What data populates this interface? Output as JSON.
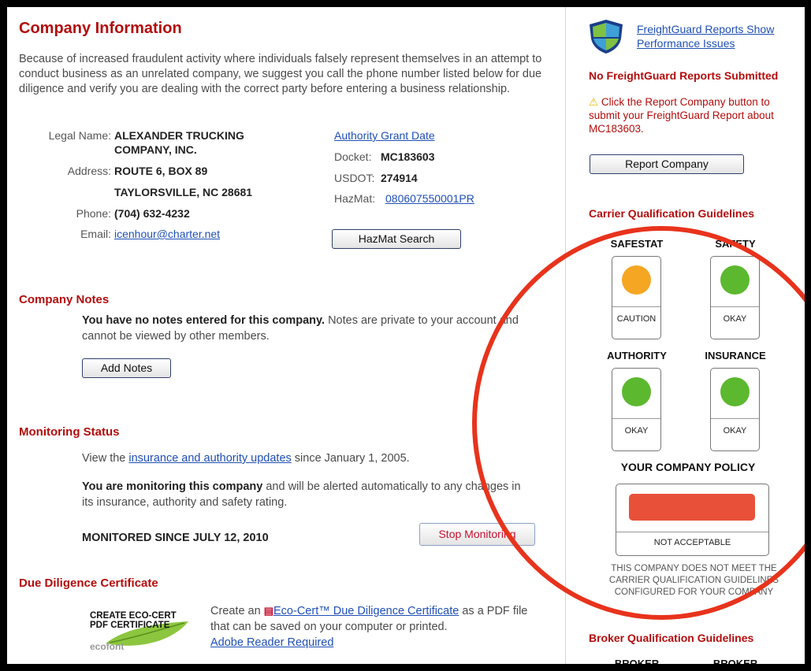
{
  "company_info": {
    "title": "Company Information",
    "intro": "Because of increased fraudulent activity where individuals falsely represent themselves in an attempt to conduct business as an unrelated company, we suggest you call the phone number listed below for due diligence and verify you are dealing with the correct party before entering a business relationship.",
    "legal_name_label": "Legal Name:",
    "legal_name_line1": "ALEXANDER TRUCKING",
    "legal_name_line2": "COMPANY, INC.",
    "address_label": "Address:",
    "address_line1": "ROUTE 6, BOX 89",
    "address_line2": "TAYLORSVILLE, NC 28681",
    "phone_label": "Phone:",
    "phone": "(704) 632-4232",
    "email_label": "Email:",
    "email": "icenhour@charter.net",
    "authority_grant_link": "Authority Grant Date",
    "docket_label": "Docket:",
    "docket": "MC183603",
    "usdot_label": "USDOT:",
    "usdot": "274914",
    "hazmat_label": "HazMat:",
    "hazmat": "080607550001PR",
    "hazmat_search_button": "HazMat Search"
  },
  "company_notes": {
    "title": "Company Notes",
    "text_bold": "You have no notes entered for this company.",
    "text_rest": " Notes are private to your account and cannot be viewed by other members.",
    "add_notes_button": "Add Notes"
  },
  "monitoring": {
    "title": "Monitoring Status",
    "view_prefix": "View the ",
    "view_link": "insurance and authority updates",
    "view_suffix": " since January 1, 2005.",
    "monitoring_bold": "You are monitoring this company",
    "monitoring_rest": " and will be alerted automatically to any changes in its insurance, authority and safety rating.",
    "since": "MONITORED SINCE JULY 12, 2010",
    "stop_button": "Stop Monitoring"
  },
  "due_diligence": {
    "title": "Due Diligence Certificate",
    "logo_line1": "CREATE ECO-CERT",
    "logo_line2": "PDF CERTIFICATE",
    "logo_brand": "ecofont",
    "text_prefix": "Create an ",
    "cert_link": "Eco-Cert™ Due Diligence Certificate",
    "text_suffix": " as a PDF file that can be saved on your computer or printed.",
    "adobe_link": "Adobe Reader Required"
  },
  "freightguard": {
    "link": "FreightGuard Reports Show Performance Issues",
    "none_submitted": "No FreightGuard Reports Submitted",
    "instruction": "Click the Report Company button to submit your FreightGuard Report about MC183603.",
    "report_button": "Report Company"
  },
  "carrier_guidelines": {
    "title": "Carrier Qualification Guidelines",
    "indicators": [
      {
        "label": "SAFESTAT",
        "status": "CAUTION",
        "color": "#f5a623"
      },
      {
        "label": "SAFETY",
        "status": "OKAY",
        "color": "#5cb82f"
      },
      {
        "label": "AUTHORITY",
        "status": "OKAY",
        "color": "#5cb82f"
      },
      {
        "label": "INSURANCE",
        "status": "OKAY",
        "color": "#5cb82f"
      }
    ],
    "policy_title": "YOUR COMPANY POLICY",
    "policy_status": "NOT ACCEPTABLE",
    "policy_color": "#e8503a",
    "policy_note": "THIS COMPANY DOES NOT MEET THE CARRIER QUALIFICATION GUIDELINES CONFIGURED FOR YOUR COMPANY"
  },
  "broker_guidelines": {
    "title": "Broker Qualification Guidelines",
    "col1": "BROKER",
    "col2": "BROKER"
  },
  "colors": {
    "heading_red": "#b30d0d",
    "link_blue": "#1f4fb5",
    "annotation_circle": "#e8331c"
  }
}
